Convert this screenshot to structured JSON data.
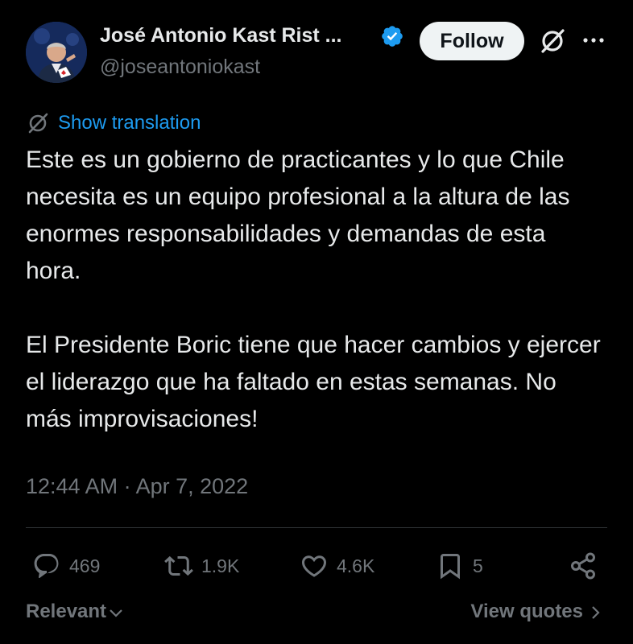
{
  "author": {
    "name": "José Antonio Kast Rist ...",
    "handle": "@joseantoniokast",
    "verified": true
  },
  "header": {
    "follow_label": "Follow",
    "grok_icon": "grok-icon",
    "more_icon": "more-icon"
  },
  "translation": {
    "label": "Show translation"
  },
  "tweet": {
    "paragraphs": [
      "Este es un gobierno de practicantes y lo que Chile necesita es un equipo profesional a la altura de las enormes responsabilidades y demandas de esta hora.",
      "El Presidente Boric tiene que hacer cambios y ejercer el liderazgo que ha faltado en estas semanas. No más improvisaciones!"
    ],
    "timestamp": "12:44 AM · Apr 7, 2022"
  },
  "actions": {
    "replies": "469",
    "reposts": "1.9K",
    "likes": "4.6K",
    "bookmarks": "5"
  },
  "footer": {
    "sort_label": "Relevant",
    "view_quotes_label": "View quotes"
  },
  "colors": {
    "background": "#000000",
    "text": "#e7e9ea",
    "secondary": "#71767b",
    "link": "#1d9bf0",
    "verified": "#1d9bf0",
    "divider": "#2f3336"
  }
}
